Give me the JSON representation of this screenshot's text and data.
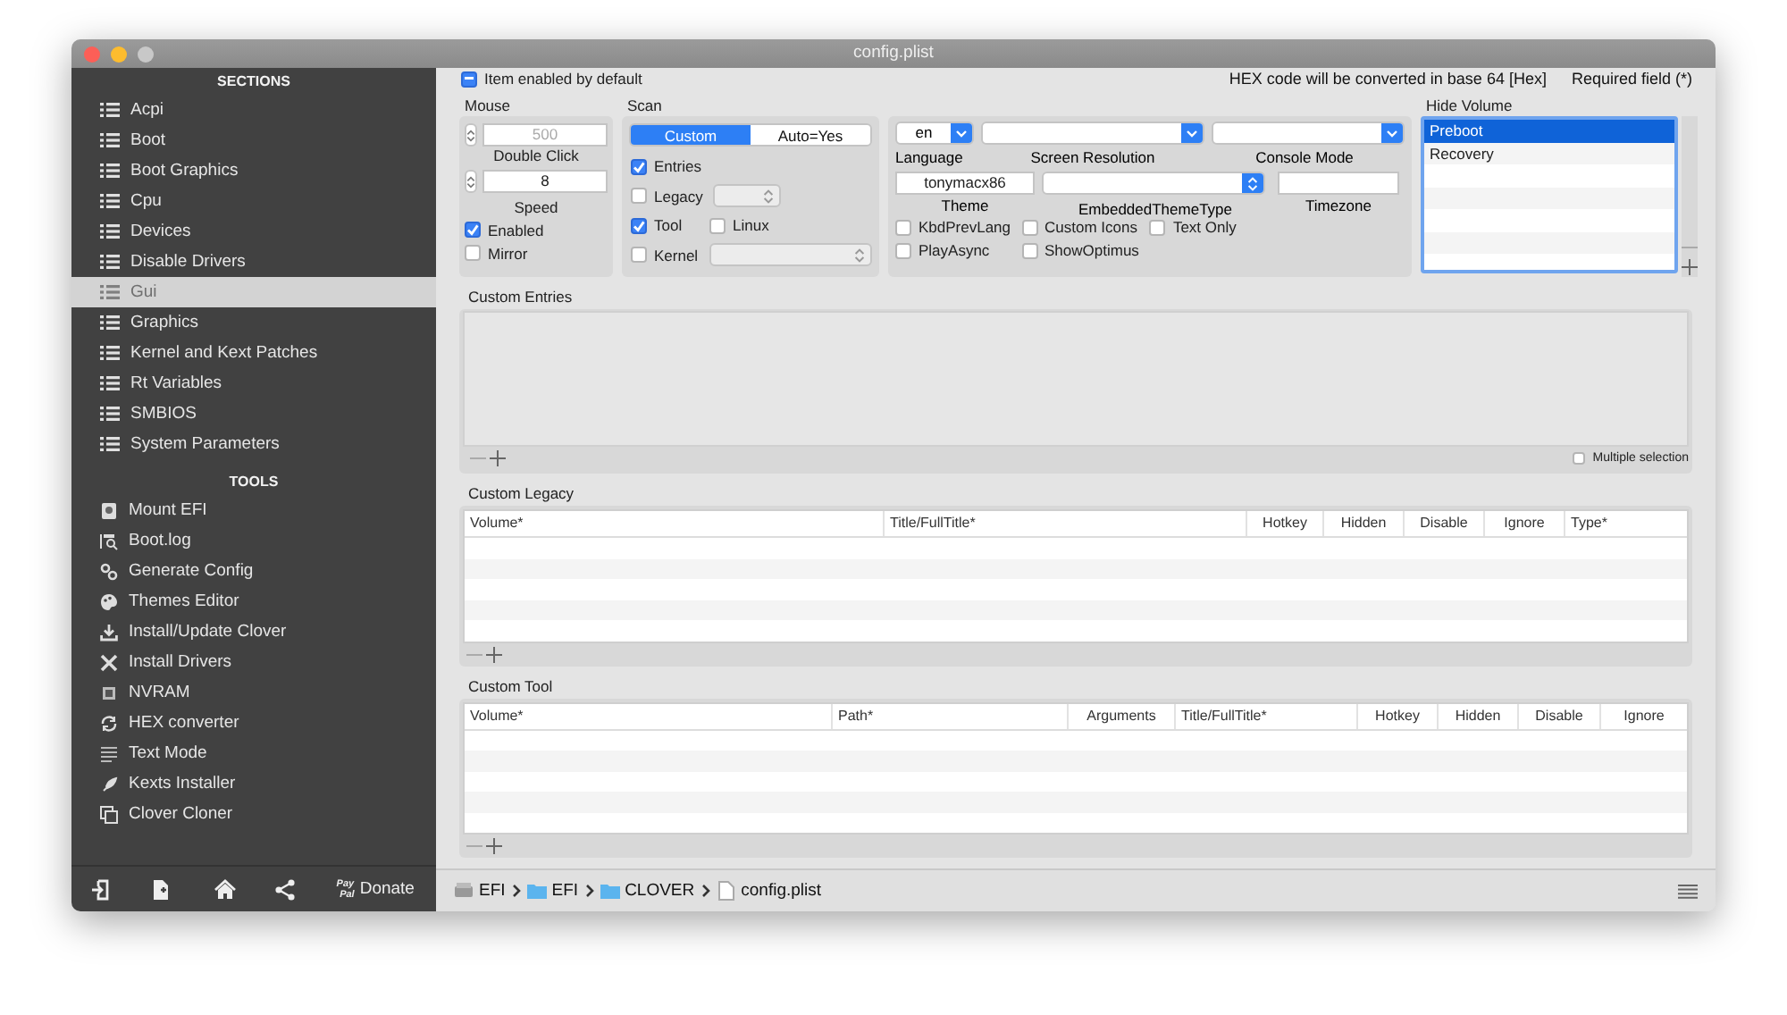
{
  "window": {
    "title": "config.plist"
  },
  "sidebar": {
    "sections_heading": "SECTIONS",
    "sections": [
      {
        "label": "Acpi",
        "selected": false
      },
      {
        "label": "Boot",
        "selected": false
      },
      {
        "label": "Boot Graphics",
        "selected": false
      },
      {
        "label": "Cpu",
        "selected": false
      },
      {
        "label": "Devices",
        "selected": false
      },
      {
        "label": "Disable Drivers",
        "selected": false
      },
      {
        "label": "Gui",
        "selected": true
      },
      {
        "label": "Graphics",
        "selected": false
      },
      {
        "label": "Kernel and Kext Patches",
        "selected": false
      },
      {
        "label": "Rt Variables",
        "selected": false
      },
      {
        "label": "SMBIOS",
        "selected": false
      },
      {
        "label": "System Parameters",
        "selected": false
      }
    ],
    "tools_heading": "TOOLS",
    "tools": [
      {
        "label": "Mount EFI"
      },
      {
        "label": "Boot.log"
      },
      {
        "label": "Generate Config"
      },
      {
        "label": "Themes Editor"
      },
      {
        "label": "Install/Update Clover"
      },
      {
        "label": "Install Drivers"
      },
      {
        "label": "NVRAM"
      },
      {
        "label": "HEX converter"
      },
      {
        "label": "Text Mode"
      },
      {
        "label": "Kexts Installer"
      },
      {
        "label": "Clover Cloner"
      }
    ],
    "donate": {
      "logo_top": "Pay",
      "logo_bottom": "Pal",
      "label": "Donate"
    }
  },
  "item_enabled": {
    "label": "Item enabled by default",
    "mixed": true
  },
  "hex_note": "HEX code will be converted in base 64 [Hex]",
  "required_note": "Required field (*)",
  "mouse": {
    "title": "Mouse",
    "double_click": {
      "value": "500",
      "label": "Double Click",
      "disabled": true
    },
    "speed": {
      "value": "8",
      "label": "Speed",
      "disabled": false
    },
    "checks": [
      {
        "label": "Enabled",
        "checked": true
      },
      {
        "label": "Mirror",
        "checked": false
      }
    ]
  },
  "scan": {
    "title": "Scan",
    "segments": [
      {
        "label": "Custom",
        "selected": true
      },
      {
        "label": "Auto=Yes",
        "selected": false
      }
    ],
    "rows": [
      [
        {
          "kind": "check",
          "label": "Entries",
          "checked": true
        }
      ],
      [
        {
          "kind": "check",
          "label": "Legacy",
          "checked": false
        },
        {
          "kind": "popup"
        }
      ],
      [
        {
          "kind": "check",
          "label": "Tool",
          "checked": true
        },
        {
          "kind": "check",
          "label": "Linux",
          "checked": false
        }
      ],
      [
        {
          "kind": "check",
          "label": "Kernel",
          "checked": false
        },
        {
          "kind": "popup"
        }
      ]
    ]
  },
  "gui": {
    "language": {
      "value": "en",
      "label": "Language"
    },
    "screen_resolution": {
      "label": "Screen Resolution"
    },
    "console_mode": {
      "label": "Console Mode"
    },
    "theme": {
      "value": "tonymacx86",
      "label": "Theme"
    },
    "embedded_theme_type": {
      "label": "EmbeddedThemeType"
    },
    "timezone": {
      "label": "Timezone"
    },
    "checks": [
      {
        "label": "KbdPrevLang",
        "checked": false
      },
      {
        "label": "Custom Icons",
        "checked": false
      },
      {
        "label": "Text Only",
        "checked": false
      },
      {
        "label": "PlayAsync",
        "checked": false
      },
      {
        "label": "ShowOptimus",
        "checked": false
      }
    ]
  },
  "hide_volume": {
    "title": "Hide Volume",
    "items": [
      {
        "label": "Preboot",
        "selected": true
      },
      {
        "label": "Recovery",
        "selected": false
      }
    ]
  },
  "custom_entries": {
    "title": "Custom Entries",
    "multiple_selection": {
      "label": "Multiple selection",
      "checked": false
    }
  },
  "custom_legacy": {
    "title": "Custom Legacy",
    "columns": [
      "Volume*",
      "Title/FullTitle*",
      "Hotkey",
      "Hidden",
      "Disable",
      "Ignore",
      "Type*"
    ]
  },
  "custom_tool": {
    "title": "Custom Tool",
    "columns": [
      "Volume*",
      "Path*",
      "Arguments",
      "Title/FullTitle*",
      "Hotkey",
      "Hidden",
      "Disable",
      "Ignore"
    ]
  },
  "path_bar": [
    {
      "kind": "drive",
      "label": "EFI"
    },
    {
      "kind": "folder",
      "label": "EFI"
    },
    {
      "kind": "folder",
      "label": "CLOVER"
    },
    {
      "kind": "file",
      "label": "config.plist"
    }
  ]
}
